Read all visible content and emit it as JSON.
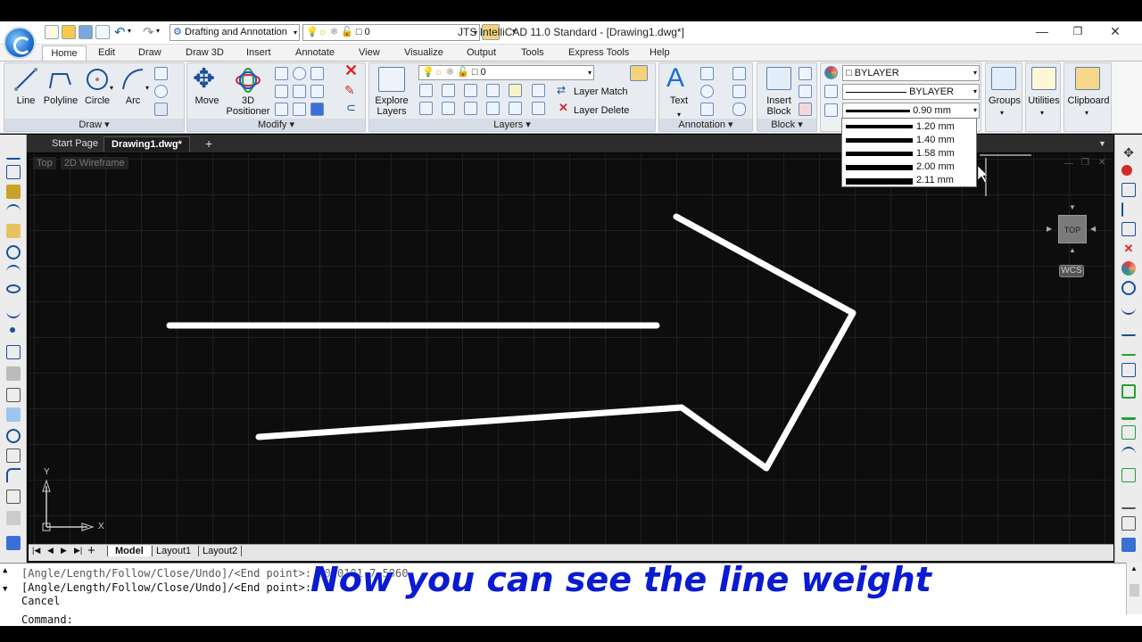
{
  "app": {
    "title": "JTS IntelliCAD 11.0 Standard - [Drawing1.dwg*]",
    "workspace": "Drafting and Annotation",
    "layer_combo": "0"
  },
  "menu_tabs": [
    "Home",
    "Edit",
    "Draw",
    "Draw 3D",
    "Insert",
    "Annotate",
    "View",
    "Visualize",
    "Output",
    "Tools",
    "Express Tools",
    "Help"
  ],
  "ribbon": {
    "draw": {
      "title": "Draw ▾",
      "line": "Line",
      "polyline": "Polyline",
      "circle": "Circle",
      "arc": "Arc"
    },
    "modify": {
      "title": "Modify ▾",
      "move": "Move",
      "positioner": "3D\nPositioner"
    },
    "layers": {
      "title": "Layers ▾",
      "explore": "Explore\nLayers",
      "layer_value": "0",
      "layer_match": "Layer Match",
      "layer_delete": "Layer Delete"
    },
    "annotation": {
      "title": "Annotation ▾",
      "text": "Text"
    },
    "block": {
      "title": "Block ▾",
      "insert": "Insert\nBlock"
    },
    "properties": {
      "color": "BYLAYER",
      "linetype": "BYLAYER",
      "lineweight": "0.90 mm"
    },
    "groups": "Groups",
    "utilities": "Utilities",
    "clipboard": "Clipboard"
  },
  "lineweight_options": [
    "1.20 mm",
    "1.40 mm",
    "1.58 mm",
    "2.00 mm",
    "2.11 mm"
  ],
  "doc_tabs": {
    "start": "Start Page",
    "drawing": "Drawing1.dwg*",
    "add": "+"
  },
  "view_labels": {
    "view": "Top",
    "style": "2D Wireframe"
  },
  "viewcube": {
    "face": "TOP",
    "wcs": "WCS"
  },
  "ucs": {
    "x": "X",
    "y": "Y"
  },
  "layout_tabs": [
    "Model",
    "Layout1",
    "Layout2"
  ],
  "command_history": [
    "[Angle/Length/Follow/Close/Undo]/<End point>: 10.0101,7.5860",
    "[Angle/Length/Follow/Close/Undo]/<End point>:",
    "Cancel"
  ],
  "command_prompt": "Command:",
  "caption": "Now you can see the line weight",
  "colors": {
    "accent": "#0a1bd1",
    "canvas": "#0d0d0d"
  }
}
